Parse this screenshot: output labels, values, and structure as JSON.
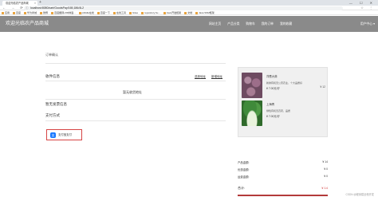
{
  "browser": {
    "tab_title": "欢迎光临农产品商城",
    "tab_close": "×",
    "new_tab": "+",
    "window_controls": "— ☐ ✕",
    "nav_buttons": "← → ⟳",
    "url": "localhost:8080/cart/GoodsPay/165,186/4L2",
    "tools": "☆ ⋮",
    "bookmarks": [
      "应用",
      "百度",
      "华为商城",
      "微博",
      "百度翻译-200种语...",
      "jsfiddle在线",
      "百度一下",
      "在线工具",
      "Gitee",
      "repository.hu...",
      "Java开发框架",
      "文档",
      "Java SSM框架"
    ]
  },
  "header": {
    "brand": "欢迎光临农产品商城",
    "nav": [
      "网站主页",
      "产品分类",
      "购物车",
      "我的订单",
      "我的收藏",
      "用户中心",
      "用户中心 zhangsanfeng"
    ],
    "user_menu": "用户中心 ▾"
  },
  "page": {
    "breadcrumb": "订单确认",
    "address_section": "收件信息",
    "address_edit": "选择地址",
    "address_add": "新增地址",
    "no_address": "暂无收货地址",
    "invoice_section": "暂无发票信息",
    "payment_section": "支付方式",
    "pay_button_icon": "支",
    "pay_button": "支付宝支付"
  },
  "summary": {
    "products": [
      {
        "image": "red-onion-image",
        "name": "洋葱大蒜",
        "desc": "新鲜有机无公害农业，个大品质好",
        "price": "¥ 7.00元/斤",
        "qty": "¥ 12"
      },
      {
        "image": "bok-choy-image",
        "name": "上海青",
        "desc": "绿色有机无农药，品质",
        "price": "¥ 7.00元/斤",
        "qty": ""
      }
    ],
    "rows": [
      {
        "label": "产品金额:",
        "value": "¥ 14"
      },
      {
        "label": "优惠金额:",
        "value": "¥ 0"
      },
      {
        "label": "运费金额:",
        "value": "¥ 0"
      }
    ],
    "total_label": "合计:",
    "total_value": "¥ 14"
  },
  "watermark": "CSDN @程序猿全栈开发",
  "colors": {
    "header_bg": "#8a8a8a",
    "accent_red": "#d64545",
    "alipay_blue": "#1677ff"
  }
}
